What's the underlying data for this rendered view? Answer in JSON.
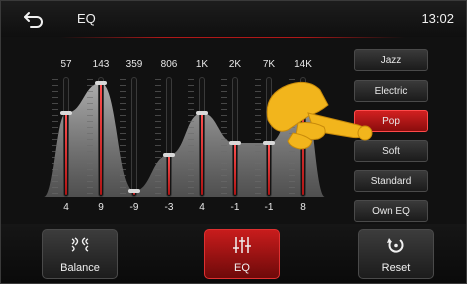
{
  "header": {
    "title": "EQ",
    "time": "13:02",
    "back_icon": "back-arrow-icon"
  },
  "eq": {
    "bands": [
      {
        "freq": "57",
        "gain": "4",
        "gain_value": 4
      },
      {
        "freq": "143",
        "gain": "9",
        "gain_value": 9
      },
      {
        "freq": "359",
        "gain": "-9",
        "gain_value": -9
      },
      {
        "freq": "806",
        "gain": "-3",
        "gain_value": -3
      },
      {
        "freq": "1K",
        "gain": "4",
        "gain_value": 4
      },
      {
        "freq": "2K",
        "gain": "-1",
        "gain_value": -1
      },
      {
        "freq": "7K",
        "gain": "-1",
        "gain_value": -1
      },
      {
        "freq": "14K",
        "gain": "8",
        "gain_value": 8
      }
    ],
    "range": [
      -10,
      10
    ]
  },
  "presets": [
    {
      "label": "Jazz",
      "active": false
    },
    {
      "label": "Electric",
      "active": false
    },
    {
      "label": "Pop",
      "active": true
    },
    {
      "label": "Soft",
      "active": false
    },
    {
      "label": "Standard",
      "active": false
    },
    {
      "label": "Own EQ",
      "active": false
    }
  ],
  "bottom": {
    "balance": {
      "label": "Balance",
      "icon": "balance-icon"
    },
    "eq": {
      "label": "EQ",
      "icon": "equalizer-icon",
      "active": true
    },
    "reset": {
      "label": "Reset",
      "icon": "reset-icon"
    }
  },
  "colors": {
    "accent": "#c81c1c",
    "background": "#111111"
  }
}
